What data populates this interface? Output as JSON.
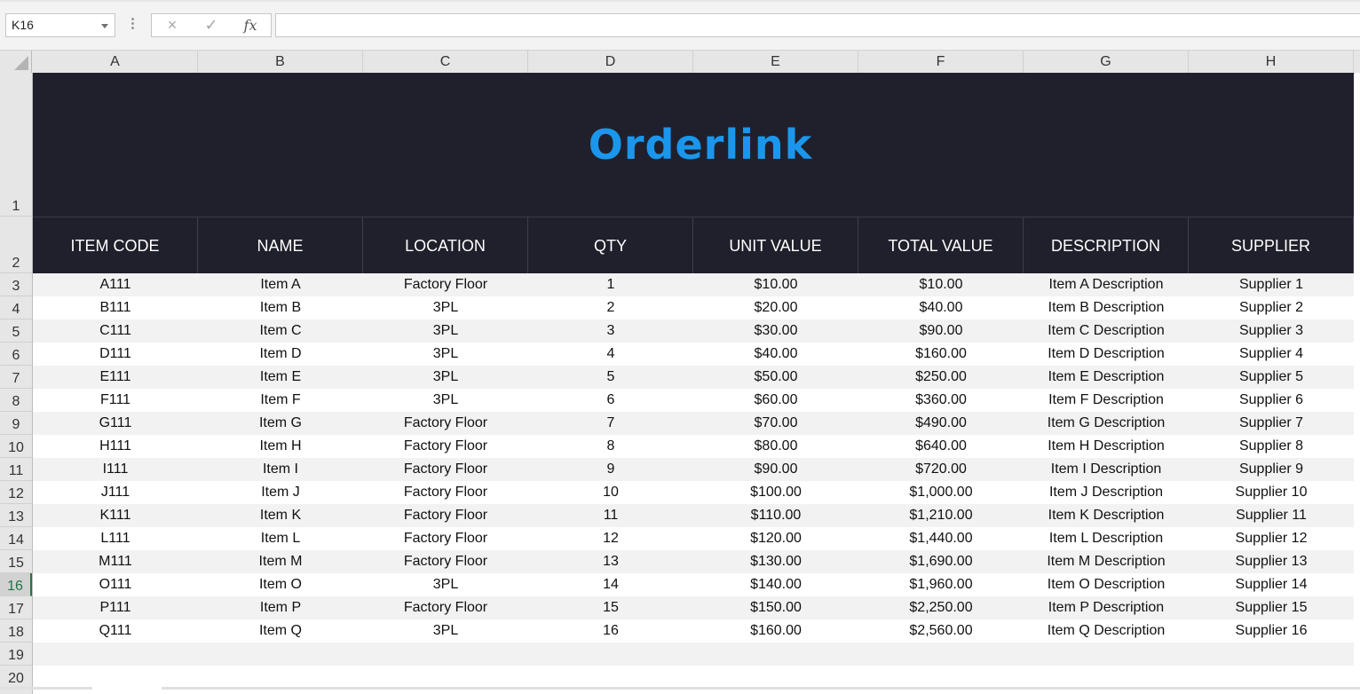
{
  "formula_bar": {
    "name_box": "K16",
    "cancel_icon": "×",
    "enter_icon": "✓",
    "fx_label": "fx",
    "formula_value": ""
  },
  "columns": [
    "A",
    "B",
    "C",
    "D",
    "E",
    "F",
    "G",
    "H"
  ],
  "rows": [
    "1",
    "2",
    "3",
    "4",
    "5",
    "6",
    "7",
    "8",
    "9",
    "10",
    "11",
    "12",
    "13",
    "14",
    "15",
    "16",
    "17",
    "18",
    "19",
    "20"
  ],
  "active_row": "16",
  "logo": {
    "text": "Orderlink",
    "color": "#1a97ec"
  },
  "colors": {
    "banner": "#20202c",
    "stripe": "#f2f2f2",
    "active": "#217346"
  },
  "table": {
    "headers": [
      "ITEM CODE",
      "NAME",
      "LOCATION",
      "QTY",
      "UNIT VALUE",
      "TOTAL VALUE",
      "DESCRIPTION",
      "SUPPLIER"
    ],
    "rows": [
      [
        "A111",
        "Item A",
        "Factory Floor",
        "1",
        "$10.00",
        "$10.00",
        "Item A Description",
        "Supplier 1"
      ],
      [
        "B111",
        "Item B",
        "3PL",
        "2",
        "$20.00",
        "$40.00",
        "Item B Description",
        "Supplier 2"
      ],
      [
        "C111",
        "Item C",
        "3PL",
        "3",
        "$30.00",
        "$90.00",
        "Item C Description",
        "Supplier 3"
      ],
      [
        "D111",
        "Item D",
        "3PL",
        "4",
        "$40.00",
        "$160.00",
        "Item D Description",
        "Supplier 4"
      ],
      [
        "E111",
        "Item E",
        "3PL",
        "5",
        "$50.00",
        "$250.00",
        "Item E Description",
        "Supplier 5"
      ],
      [
        "F111",
        "Item F",
        "3PL",
        "6",
        "$60.00",
        "$360.00",
        "Item F Description",
        "Supplier 6"
      ],
      [
        "G111",
        "Item G",
        "Factory Floor",
        "7",
        "$70.00",
        "$490.00",
        "Item G Description",
        "Supplier 7"
      ],
      [
        "H111",
        "Item H",
        "Factory Floor",
        "8",
        "$80.00",
        "$640.00",
        "Item H Description",
        "Supplier 8"
      ],
      [
        "I111",
        "Item I",
        "Factory Floor",
        "9",
        "$90.00",
        "$720.00",
        "Item I Description",
        "Supplier 9"
      ],
      [
        "J111",
        "Item J",
        "Factory Floor",
        "10",
        "$100.00",
        "$1,000.00",
        "Item J Description",
        "Supplier 10"
      ],
      [
        "K111",
        "Item K",
        "Factory Floor",
        "11",
        "$110.00",
        "$1,210.00",
        "Item K Description",
        "Supplier 11"
      ],
      [
        "L111",
        "Item L",
        "Factory Floor",
        "12",
        "$120.00",
        "$1,440.00",
        "Item L Description",
        "Supplier 12"
      ],
      [
        "M111",
        "Item M",
        "Factory Floor",
        "13",
        "$130.00",
        "$1,690.00",
        "Item M Description",
        "Supplier 13"
      ],
      [
        "O111",
        "Item O",
        "3PL",
        "14",
        "$140.00",
        "$1,960.00",
        "Item O Description",
        "Supplier 14"
      ],
      [
        "P111",
        "Item P",
        "Factory Floor",
        "15",
        "$150.00",
        "$2,250.00",
        "Item P Description",
        "Supplier 15"
      ],
      [
        "Q111",
        "Item Q",
        "3PL",
        "16",
        "$160.00",
        "$2,560.00",
        "Item Q Description",
        "Supplier 16"
      ]
    ]
  }
}
